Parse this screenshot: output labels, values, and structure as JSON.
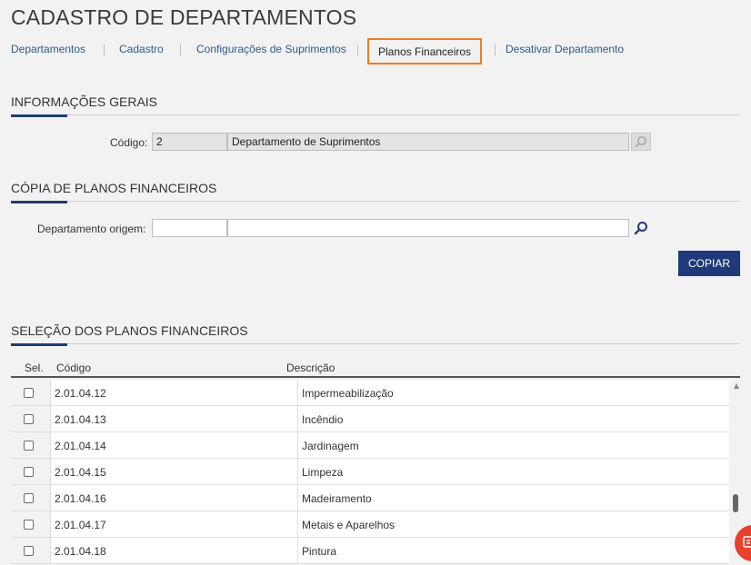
{
  "page": {
    "title": "CADASTRO DE DEPARTAMENTOS"
  },
  "tabs": [
    {
      "label": "Departamentos"
    },
    {
      "label": "Cadastro"
    },
    {
      "label": "Configurações de Suprimentos"
    },
    {
      "label": "Planos Financeiros",
      "active": true
    },
    {
      "label": "Desativar Departamento"
    }
  ],
  "general_info": {
    "title": "INFORMAÇÕES GERAIS",
    "code_label": "Código:",
    "code_value": "2",
    "name_value": "Departamento de Suprimentos"
  },
  "copy_plans": {
    "title": "CÓPIA DE PLANOS FINANCEIROS",
    "origin_label": "Departamento origem:",
    "origin_code": "",
    "origin_name": "",
    "copy_button": "COPIAR"
  },
  "selection": {
    "title": "SELEÇÃO DOS PLANOS FINANCEIROS",
    "columns": {
      "sel": "Sel.",
      "code": "Código",
      "description": "Descrição"
    },
    "rows": [
      {
        "code": "2.01.04.12",
        "description": "Impermeabilização",
        "checked": false
      },
      {
        "code": "2.01.04.13",
        "description": "Incêndio",
        "checked": false
      },
      {
        "code": "2.01.04.14",
        "description": "Jardinagem",
        "checked": false
      },
      {
        "code": "2.01.04.15",
        "description": "Limpeza",
        "checked": false
      },
      {
        "code": "2.01.04.16",
        "description": "Madeiramento",
        "checked": false
      },
      {
        "code": "2.01.04.17",
        "description": "Metais e Aparelhos",
        "checked": false
      },
      {
        "code": "2.01.04.18",
        "description": "Pintura",
        "checked": false
      }
    ]
  },
  "colors": {
    "accent": "#1f3d73",
    "active_tab_border": "#f07c22",
    "primary_button": "#1f3a7a",
    "link": "#2c5a8c",
    "chat_widget": "#e8402a"
  },
  "icons": {
    "search": "search-icon",
    "chat": "chat-icon"
  }
}
